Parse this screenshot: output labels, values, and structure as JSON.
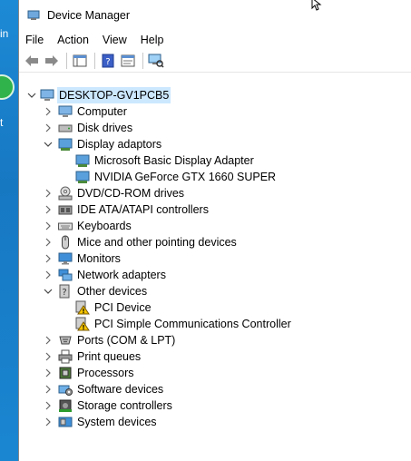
{
  "desktop": {
    "text_1": "in",
    "text_2": "t"
  },
  "window": {
    "title": "Device Manager"
  },
  "menu": [
    "File",
    "Action",
    "View",
    "Help"
  ],
  "toolbar": {
    "buttons": [
      "back-icon",
      "forward-icon",
      "show-hide-tree-icon",
      "help-icon",
      "properties-icon",
      "scan-hardware-icon"
    ]
  },
  "tree": {
    "root": "DESKTOP-GV1PCB5",
    "items": [
      {
        "label": "Computer",
        "icon": "computer-icon",
        "expanded": false
      },
      {
        "label": "Disk drives",
        "icon": "disk-drive-icon",
        "expanded": false
      },
      {
        "label": "Display adaptors",
        "icon": "display-adapter-icon",
        "expanded": true,
        "children": [
          "Microsoft Basic Display Adapter",
          "NVIDIA GeForce GTX 1660 SUPER"
        ]
      },
      {
        "label": "DVD/CD-ROM drives",
        "icon": "dvd-icon",
        "expanded": false
      },
      {
        "label": "IDE ATA/ATAPI controllers",
        "icon": "ide-controller-icon",
        "expanded": false
      },
      {
        "label": "Keyboards",
        "icon": "keyboard-icon",
        "expanded": false
      },
      {
        "label": "Mice and other pointing devices",
        "icon": "mouse-icon",
        "expanded": false
      },
      {
        "label": "Monitors",
        "icon": "monitor-icon",
        "expanded": false
      },
      {
        "label": "Network adapters",
        "icon": "network-adapter-icon",
        "expanded": false
      },
      {
        "label": "Other devices",
        "icon": "other-devices-icon",
        "expanded": true,
        "children": [
          "PCI Device",
          "PCI Simple Communications Controller"
        ]
      },
      {
        "label": "Ports (COM & LPT)",
        "icon": "ports-icon",
        "expanded": false
      },
      {
        "label": "Print queues",
        "icon": "printer-icon",
        "expanded": false
      },
      {
        "label": "Processors",
        "icon": "processor-icon",
        "expanded": false
      },
      {
        "label": "Software devices",
        "icon": "software-device-icon",
        "expanded": false
      },
      {
        "label": "Storage controllers",
        "icon": "storage-controller-icon",
        "expanded": false
      },
      {
        "label": "System devices",
        "icon": "system-devices-icon",
        "expanded": false
      }
    ]
  },
  "colors": {
    "desktop": "#1a7fc9",
    "selection": "#cce8ff",
    "warning": "#f5c400"
  }
}
